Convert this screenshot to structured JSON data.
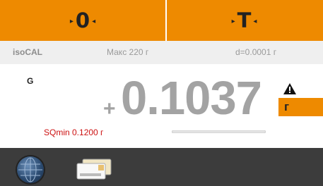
{
  "top_bar": {
    "zero_label": "0",
    "tare_label": "T"
  },
  "info_bar": {
    "cal_label": "isoCAL",
    "max_capacity": "Макс 220 г",
    "readability": "d=0.0001 г"
  },
  "weighing": {
    "mode": "G",
    "sign": "+",
    "value": "0.1037",
    "unit": "г",
    "stability_warning_icon": "warning-icon",
    "sqmin": "SQmin 0.1200 г",
    "capacity_used_fraction": 0.0005
  },
  "taskbar": {
    "icons": [
      "globe-icon",
      "card-icon"
    ]
  },
  "colors": {
    "accent": "#ee8a00",
    "weight_text": "#a3a3a3",
    "sqmin_text": "#cc1111",
    "taskbar": "#3c3c3c"
  }
}
